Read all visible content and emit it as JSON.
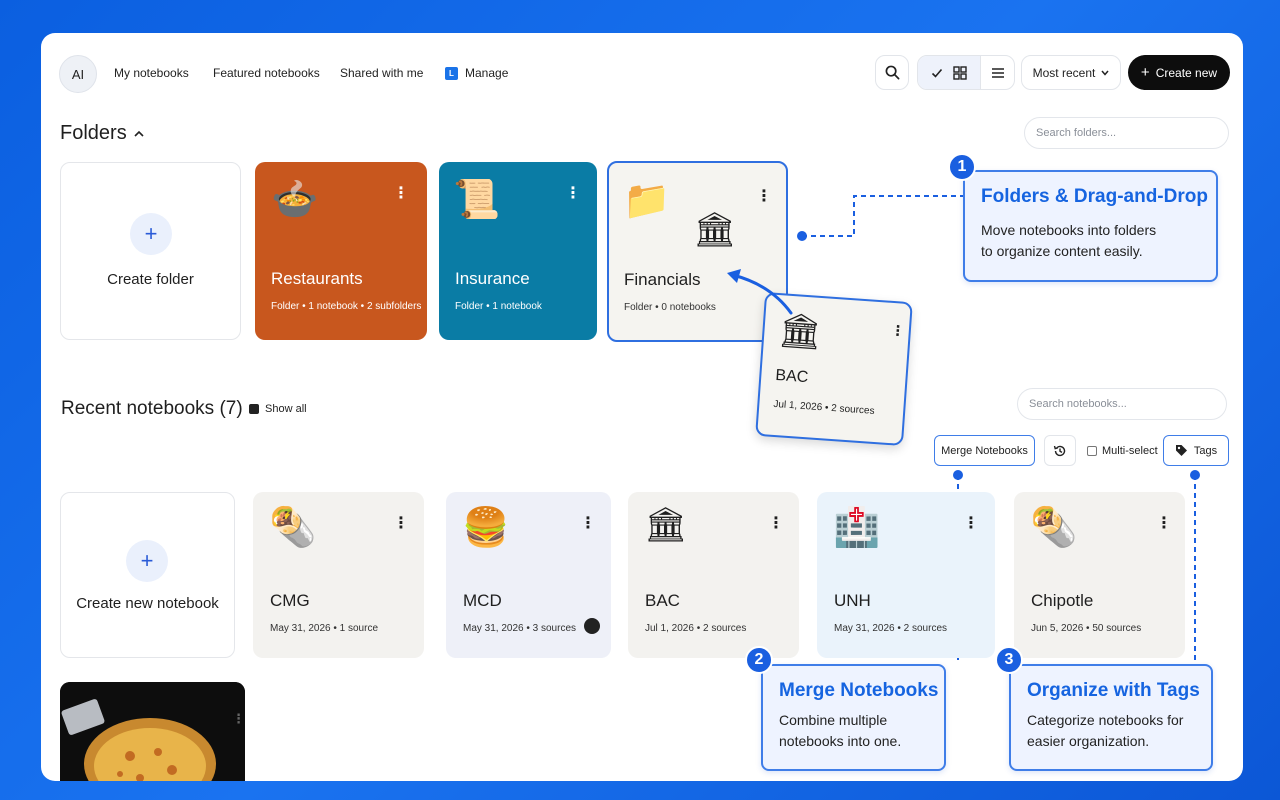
{
  "topbar": {
    "avatar": "AI",
    "nav": [
      "My notebooks",
      "Featured notebooks",
      "Shared with me",
      "Manage"
    ],
    "sort_label": "Most recent",
    "create_label": "Create new"
  },
  "folders": {
    "title": "Folders",
    "search_placeholder": "Search folders...",
    "create_label": "Create folder",
    "items": [
      {
        "name": "Restaurants",
        "meta": "Folder • 1 notebook • 2 subfolders",
        "icon": "pot-of-food-icon",
        "color": "#c8571e"
      },
      {
        "name": "Insurance",
        "meta": "Folder • 1 notebook",
        "icon": "scroll-icon",
        "color": "#0a7ca5"
      },
      {
        "name": "Financials",
        "meta": "Folder • 0 notebooks",
        "icon": "folder-icon",
        "color": "#f5f4f0"
      }
    ],
    "drag_card": {
      "name": "BAC",
      "meta": "Jul 1, 2026 • 2 sources"
    }
  },
  "notebooks": {
    "title": "Recent notebooks (7)",
    "show_all": "Show all",
    "search_placeholder": "Search notebooks...",
    "merge_label": "Merge Notebooks",
    "multiselect_label": "Multi-select",
    "tags_label": "Tags",
    "create_label": "Create new notebook",
    "items": [
      {
        "name": "CMG",
        "meta": "May 31, 2026 • 1 source",
        "icon": "burrito-icon"
      },
      {
        "name": "MCD",
        "meta": "May 31, 2026 • 3 sources",
        "icon": "hamburger-icon"
      },
      {
        "name": "BAC",
        "meta": "Jul 1, 2026 • 2 sources",
        "icon": "bank-icon"
      },
      {
        "name": "UNH",
        "meta": "May 31, 2026 • 2 sources",
        "icon": "hospital-icon"
      },
      {
        "name": "Chipotle",
        "meta": "Jun 5, 2026 • 50 sources",
        "icon": "burrito-icon"
      }
    ]
  },
  "callouts": [
    {
      "num": "1",
      "title": "Folders & Drag-and-Drop",
      "line1": "Move notebooks into folders",
      "line2": "to organize content easily."
    },
    {
      "num": "2",
      "title": "Merge Notebooks",
      "line1": "Combine multiple",
      "line2": "notebooks into one."
    },
    {
      "num": "3",
      "title": "Organize with Tags",
      "line1": "Categorize notebooks for",
      "line2": "easier organization."
    }
  ],
  "colors": {
    "accent": "#1a5fe0",
    "background": "#0b5fe0"
  }
}
